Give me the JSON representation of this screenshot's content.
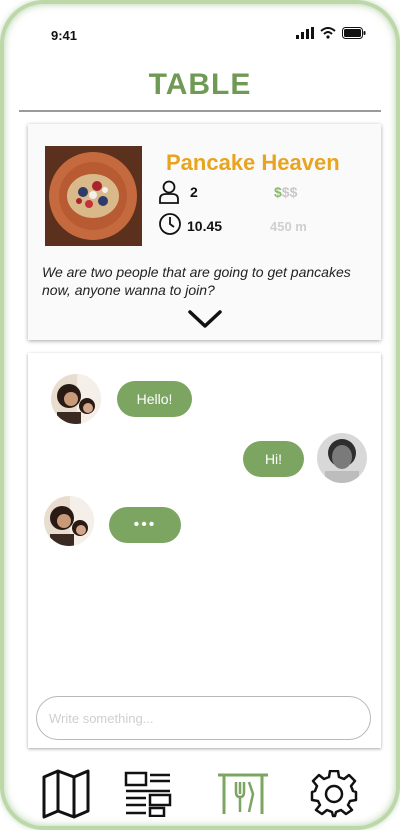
{
  "status_bar": {
    "time": "9:41"
  },
  "header": {
    "title": "TABLE"
  },
  "restaurant": {
    "name": "Pancake Heaven",
    "people": "2",
    "price_active": "$",
    "price_inactive": "$$",
    "time": "10.45",
    "distance": "450 m",
    "description": "We are two people that are going to get pancakes now, anyone wanna to join?"
  },
  "chat": {
    "messages": [
      {
        "from": "other",
        "text": "Hello!"
      },
      {
        "from": "me",
        "text": "Hi!"
      },
      {
        "from": "other",
        "text": "•••"
      }
    ],
    "input_placeholder": "Write something..."
  },
  "nav": {
    "items": [
      "map-icon",
      "list-icon",
      "table-icon",
      "settings-icon"
    ]
  },
  "colors": {
    "brand_green": "#6f9a54",
    "bubble_green": "#7ba561",
    "title_orange": "#e8a420"
  }
}
